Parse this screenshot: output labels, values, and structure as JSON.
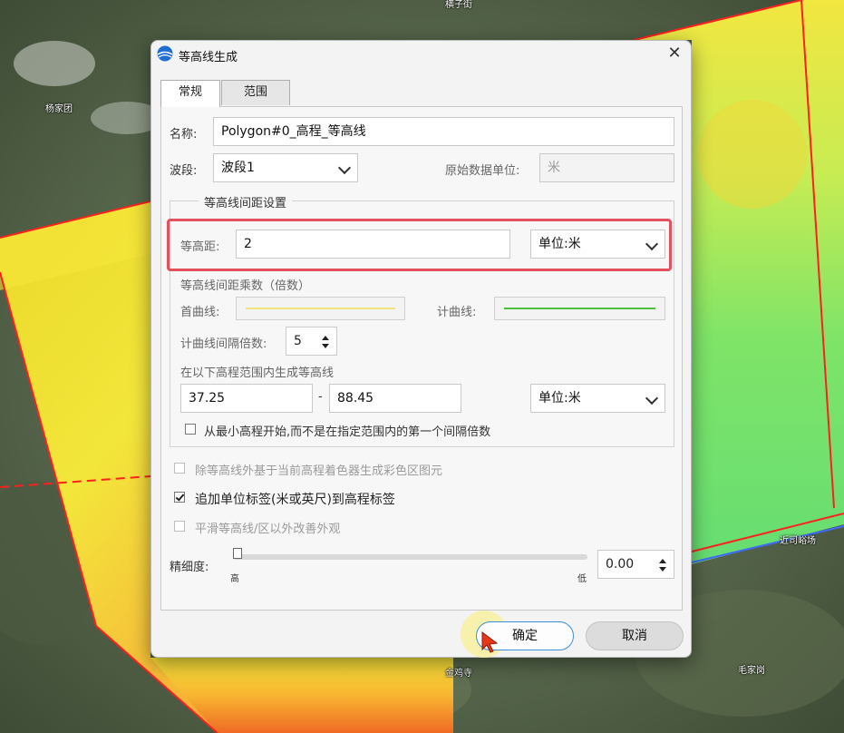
{
  "map": {
    "labels": [
      "杨家团",
      "金鸡寺",
      "毛家岗",
      "近司峪场",
      "横子街"
    ]
  },
  "dialog": {
    "title": "等高线生成",
    "close_glyph": "✕",
    "tabs": [
      {
        "label": "常规",
        "active": true
      },
      {
        "label": "范围",
        "active": false
      }
    ],
    "name_label": "名称:",
    "name_value": "Polygon#0_高程_等高线",
    "band_label": "波段:",
    "band_value": "波段1",
    "original_unit_label": "原始数据单位:",
    "original_unit_value": "米",
    "interval_group": {
      "title": "等高线间距设置",
      "interval_label": "等高距:",
      "interval_value": "2",
      "unit_select": "单位:米",
      "multiplier_label": "等高线间距乘数（倍数）",
      "first_line_label": "首曲线:",
      "first_line_color": "#f2e37a",
      "index_line_label": "计曲线:",
      "index_line_color": "#4cc23a",
      "index_multiple_label": "计曲线间隔倍数:",
      "index_multiple_value": "5",
      "range_label": "在以下高程范围内生成等高线",
      "range_min": "37.25",
      "range_sep": "-",
      "range_max": "88.45",
      "range_unit_select": "单位:米",
      "start_from_min_label": "从最小高程开始,而不是在指定范围内的第一个间隔倍数",
      "start_from_min_checked": false
    },
    "options": [
      {
        "label": "除等高线外基于当前高程着色器生成彩色区图元",
        "checked": false,
        "enabled": false
      },
      {
        "label": "追加单位标签(米或英尺)到高程标签",
        "checked": true,
        "enabled": true
      },
      {
        "label": "平滑等高线/区以外改善外观",
        "checked": false,
        "enabled": false
      }
    ],
    "precision": {
      "label": "精细度:",
      "high_label": "高",
      "low_label": "低",
      "value": "0.00",
      "slider_fraction": 0.0
    },
    "ok_button": "确定",
    "cancel_button": "取消",
    "highlight_color": "#e5505f"
  }
}
